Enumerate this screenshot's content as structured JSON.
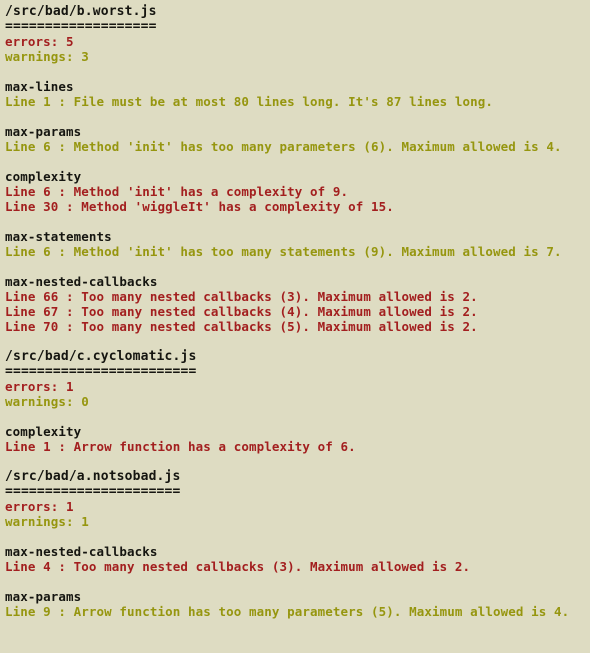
{
  "terminal": {
    "background_color": "#dedcc2",
    "error_color": "#a31f1f",
    "warning_color": "#96960f",
    "heading_color": "#151510",
    "divider_char": "=",
    "errors_label": "errors:",
    "warnings_label": "warnings:"
  },
  "files": [
    {
      "path": "/src/bad/b.worst.js",
      "divider": "===================",
      "errors_line": "errors: 5",
      "warnings_line": "warnings: 3",
      "errors": 5,
      "warnings": 3,
      "rules": [
        {
          "name": "max-lines",
          "messages": [
            {
              "text": "Line 1 : File must be at most 80 lines long. It's 87 lines long.",
              "severity": "warning"
            }
          ]
        },
        {
          "name": "max-params",
          "messages": [
            {
              "text": "Line 6 : Method 'init' has too many parameters (6). Maximum allowed is 4.",
              "severity": "warning"
            }
          ]
        },
        {
          "name": "complexity",
          "messages": [
            {
              "text": "Line 6 : Method 'init' has a complexity of 9.",
              "severity": "error"
            },
            {
              "text": "Line 30 : Method 'wiggleIt' has a complexity of 15.",
              "severity": "error"
            }
          ]
        },
        {
          "name": "max-statements",
          "messages": [
            {
              "text": "Line 6 : Method 'init' has too many statements (9). Maximum allowed is 7.",
              "severity": "warning"
            }
          ]
        },
        {
          "name": "max-nested-callbacks",
          "messages": [
            {
              "text": "Line 66 : Too many nested callbacks (3). Maximum allowed is 2.",
              "severity": "error"
            },
            {
              "text": "Line 67 : Too many nested callbacks (4). Maximum allowed is 2.",
              "severity": "error"
            },
            {
              "text": "Line 70 : Too many nested callbacks (5). Maximum allowed is 2.",
              "severity": "error"
            }
          ]
        }
      ]
    },
    {
      "path": "/src/bad/c.cyclomatic.js",
      "divider": "========================",
      "errors_line": "errors: 1",
      "warnings_line": "warnings: 0",
      "errors": 1,
      "warnings": 0,
      "rules": [
        {
          "name": "complexity",
          "messages": [
            {
              "text": "Line 1 : Arrow function has a complexity of 6.",
              "severity": "error"
            }
          ]
        }
      ]
    },
    {
      "path": "/src/bad/a.notsobad.js",
      "divider": "======================",
      "errors_line": "errors: 1",
      "warnings_line": "warnings: 1",
      "errors": 1,
      "warnings": 1,
      "rules": [
        {
          "name": "max-nested-callbacks",
          "messages": [
            {
              "text": "Line 4 : Too many nested callbacks (3). Maximum allowed is 2.",
              "severity": "error"
            }
          ]
        },
        {
          "name": "max-params",
          "messages": [
            {
              "text": "Line 9 : Arrow function has too many parameters (5). Maximum allowed is 4.",
              "severity": "warning"
            }
          ]
        }
      ]
    }
  ]
}
